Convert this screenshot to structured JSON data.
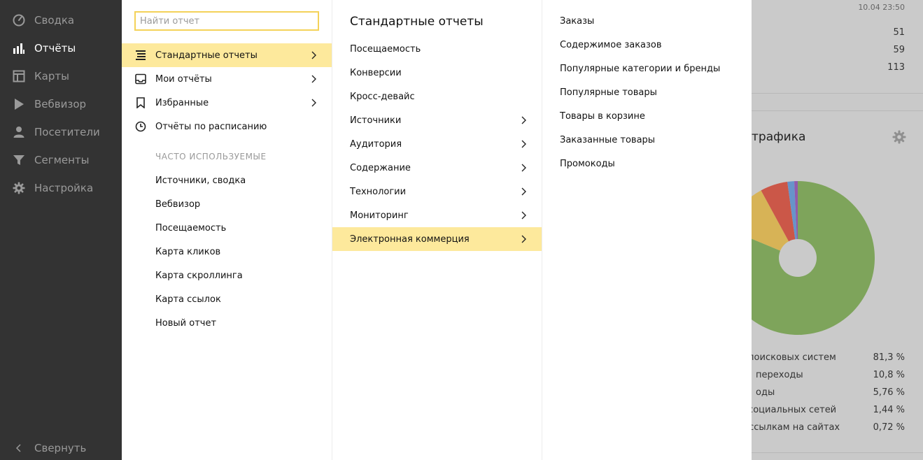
{
  "sidebar": {
    "items": [
      {
        "label": "Сводка",
        "icon": "gauge-icon"
      },
      {
        "label": "Отчёты",
        "icon": "bar-chart-icon",
        "active": true
      },
      {
        "label": "Карты",
        "icon": "map-layout-icon"
      },
      {
        "label": "Вебвизор",
        "icon": "play-icon"
      },
      {
        "label": "Посетители",
        "icon": "user-icon"
      },
      {
        "label": "Сегменты",
        "icon": "filter-icon"
      },
      {
        "label": "Настройка",
        "icon": "gear-icon"
      }
    ],
    "collapse_label": "Свернуть"
  },
  "menu": {
    "search_placeholder": "Найти отчет",
    "items": [
      {
        "label": "Стандартные отчеты",
        "icon": "report-list-icon",
        "selected": true
      },
      {
        "label": "Мои отчёты",
        "icon": "tray-icon"
      },
      {
        "label": "Избранные",
        "icon": "bookmark-icon"
      },
      {
        "label": "Отчёты по расписанию",
        "icon": "clock-icon"
      }
    ],
    "frequent_heading": "ЧАСТО ИСПОЛЬЗУЕМЫЕ",
    "frequent": [
      "Источники, сводка",
      "Вебвизор",
      "Посещаемость",
      "Карта кликов",
      "Карта скроллинга",
      "Карта ссылок",
      "Новый отчет"
    ]
  },
  "standard": {
    "title": "Стандартные отчеты",
    "items": [
      {
        "label": "Посещаемость"
      },
      {
        "label": "Конверсии"
      },
      {
        "label": "Кросс-девайс"
      },
      {
        "label": "Источники",
        "sub": true
      },
      {
        "label": "Аудитория",
        "sub": true
      },
      {
        "label": "Содержание",
        "sub": true
      },
      {
        "label": "Технологии",
        "sub": true
      },
      {
        "label": "Мониторинг",
        "sub": true
      },
      {
        "label": "Электронная коммерция",
        "sub": true,
        "selected": true
      }
    ]
  },
  "ecommerce": {
    "items": [
      "Заказы",
      "Содержимое заказов",
      "Популярные категории и бренды",
      "Популярные товары",
      "Товары в корзине",
      "Заказанные товары",
      "Промокоды"
    ]
  },
  "background": {
    "timestamp": "10.04 23:50",
    "counts": [
      "51",
      "59",
      "113"
    ],
    "widget_title": "трафика",
    "pie_colors": [
      "#76a04f",
      "#d9b14a",
      "#cc4b3a",
      "#5d8fc9",
      "#8b4fa8"
    ],
    "legend": [
      {
        "label": "з поисковых систем",
        "value": "81,3 %"
      },
      {
        "label": "переходы",
        "value": "10,8 %"
      },
      {
        "label": "оды",
        "value": "5,76 %"
      },
      {
        "label": "з социальных сетей",
        "value": "1,44 %"
      },
      {
        "label": "о ссылкам на сайтах",
        "value": "0,72 %"
      }
    ],
    "chart_data": {
      "type": "pie",
      "categories": [
        "з поисковых систем",
        "переходы",
        "оды",
        "з социальных сетей",
        "о ссылкам на сайтах"
      ],
      "values": [
        81.3,
        10.8,
        5.76,
        1.44,
        0.72
      ]
    }
  }
}
